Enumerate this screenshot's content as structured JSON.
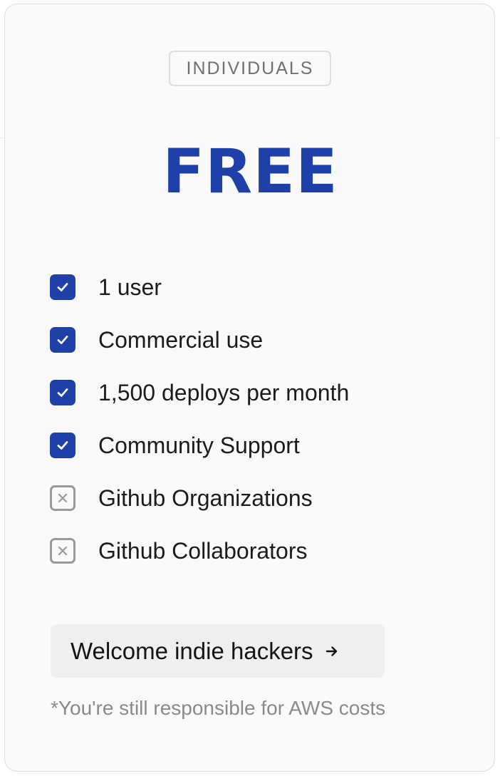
{
  "plan": {
    "badge": "INDIVIDUALS",
    "price": "FREE",
    "features": [
      {
        "label": "1 user",
        "included": true
      },
      {
        "label": "Commercial use",
        "included": true
      },
      {
        "label": "1,500 deploys per month",
        "included": true
      },
      {
        "label": "Community Support",
        "included": true
      },
      {
        "label": "Github Organizations",
        "included": false
      },
      {
        "label": "Github Collaborators",
        "included": false
      }
    ],
    "cta_label": "Welcome indie hackers",
    "cta_icon": "arrow-right-icon",
    "footnote": "*You're still responsible for AWS costs"
  },
  "colors": {
    "accent": "#1f3fa9",
    "card_background": "#fafafa",
    "button_background": "#efefef",
    "muted_text": "#8a8a8a"
  }
}
